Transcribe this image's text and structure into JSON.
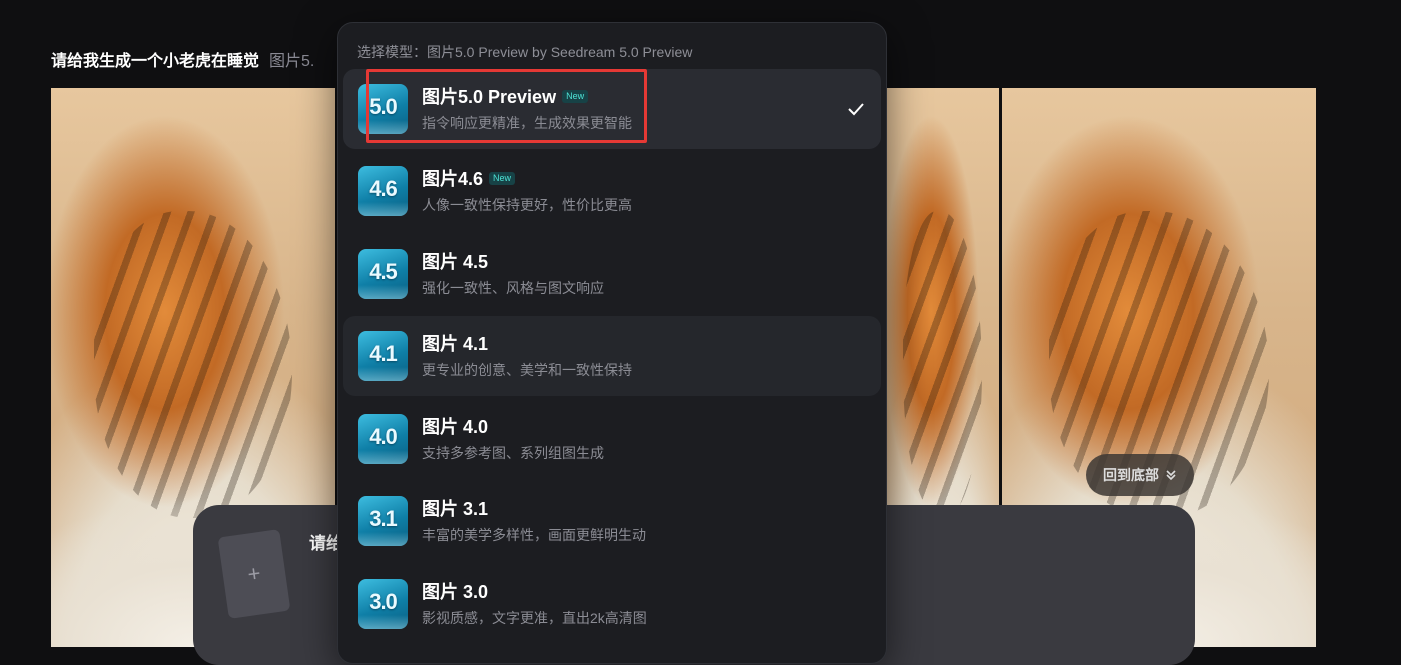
{
  "prompt": {
    "text": "请给我生成一个小老虎在睡觉",
    "meta": "图片5."
  },
  "floating_button": {
    "label": "回到底部",
    "icon": "chevron-double-down-icon"
  },
  "composer": {
    "text": "请给",
    "upload_icon": "plus-icon"
  },
  "dropdown": {
    "header": "选择模型：图片5.0 Preview by Seedream 5.0 Preview",
    "items": [
      {
        "title": "图片5.0 Preview",
        "badge": "New",
        "desc": "指令响应更精准，生成效果更智能",
        "icon_text": "5.0",
        "selected": true
      },
      {
        "title": "图片4.6",
        "badge": "New",
        "desc": "人像一致性保持更好，性价比更高",
        "icon_text": "4.6",
        "selected": false
      },
      {
        "title": "图片 4.5",
        "badge": "",
        "desc": "强化一致性、风格与图文响应",
        "icon_text": "4.5",
        "selected": false
      },
      {
        "title": "图片 4.1",
        "badge": "",
        "desc": "更专业的创意、美学和一致性保持",
        "icon_text": "4.1",
        "selected": false
      },
      {
        "title": "图片 4.0",
        "badge": "",
        "desc": "支持多参考图、系列组图生成",
        "icon_text": "4.0",
        "selected": false
      },
      {
        "title": "图片 3.1",
        "badge": "",
        "desc": "丰富的美学多样性，画面更鲜明生动",
        "icon_text": "3.1",
        "selected": false
      },
      {
        "title": "图片 3.0",
        "badge": "",
        "desc": "影视质感，文字更准，直出2k高清图",
        "icon_text": "3.0",
        "selected": false
      }
    ]
  },
  "colors": {
    "highlight": "#e53935",
    "badge_text": "#4ee3d6",
    "panel_bg": "#1c1d21"
  }
}
